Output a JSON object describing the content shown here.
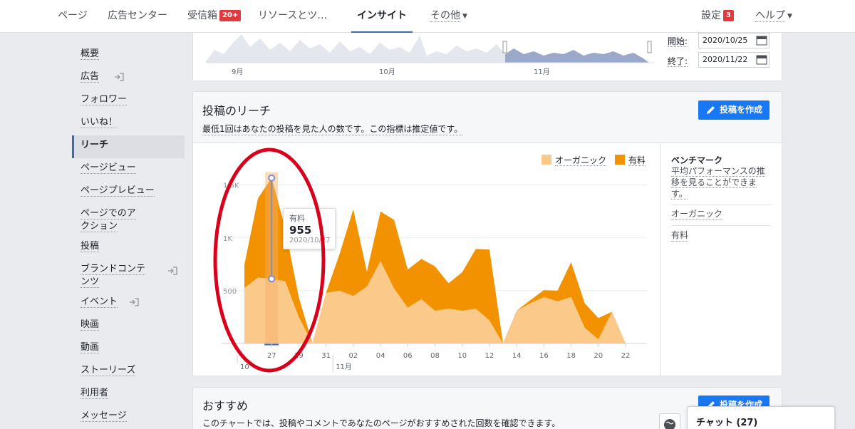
{
  "nav": {
    "page": "ページ",
    "ad_center": "広告センター",
    "inbox": "受信箱",
    "inbox_badge": "20+",
    "resources": "リソースとツ…",
    "insights": "インサイト",
    "more": "その他",
    "settings": "設定",
    "settings_badge": "3",
    "help": "ヘルプ"
  },
  "sidebar": {
    "items": [
      {
        "label": "概要"
      },
      {
        "label": "広告"
      },
      {
        "label": "フォロワー"
      },
      {
        "label": "いいね！"
      },
      {
        "label": "リーチ"
      },
      {
        "label": "ページビュー"
      },
      {
        "label": "ページプレビュー"
      },
      {
        "label": "ページでのアクション"
      },
      {
        "label": "投稿"
      },
      {
        "label": "ブランドコンテンツ"
      },
      {
        "label": "イベント"
      },
      {
        "label": "映画"
      },
      {
        "label": "動画"
      },
      {
        "label": "ストーリーズ"
      },
      {
        "label": "利用者"
      },
      {
        "label": "メッセージ"
      }
    ]
  },
  "range": {
    "months": [
      "9月",
      "10月",
      "11月"
    ],
    "start_label": "開始:",
    "start_value": "2020/10/25",
    "end_label": "終了:",
    "end_value": "2020/11/22"
  },
  "reach_card": {
    "title": "投稿のリーチ",
    "subtitle": "最低1回はあなたの投稿を見た人の数です。この指標は推定値です。",
    "create_button": "投稿を作成"
  },
  "tooltip": {
    "series": "有料",
    "value": "955",
    "date": "2020/10/27"
  },
  "benchmark": {
    "title": "ベンチマーク",
    "desc": "平均パフォーマンスの推移を見ることができます。",
    "organic": "オーガニック",
    "paid": "有料"
  },
  "recommend_card": {
    "title": "おすすめ",
    "subtitle": "このチャートでは、投稿やコメントであなたのページがおすすめされた回数を確認できます。",
    "create_button": "投稿を作成"
  },
  "chat": {
    "label": "チャット (27)"
  },
  "colors": {
    "organic": "#fbc98a",
    "paid": "#f39200",
    "accent": "#4267b2",
    "button": "#1877f2",
    "annotation": "#d9001b"
  },
  "chart_data": {
    "type": "area",
    "stacked": true,
    "legend": [
      "オーガニック",
      "有料"
    ],
    "legend_position": "top-right",
    "yticks": [
      "500",
      "1K",
      "1.5K"
    ],
    "ylim": [
      0,
      1700
    ],
    "x": [
      "10/25",
      "10/26",
      "10/27",
      "10/28",
      "10/29",
      "10/30",
      "10/31",
      "11/01",
      "11/02",
      "11/03",
      "11/04",
      "11/05",
      "11/06",
      "11/07",
      "11/08",
      "11/09",
      "11/10",
      "11/11",
      "11/12",
      "11/13",
      "11/14",
      "11/15",
      "11/16",
      "11/17",
      "11/18",
      "11/19",
      "11/20",
      "11/21",
      "11/22"
    ],
    "xtick_labels": [
      "27",
      "29",
      "31",
      "02",
      "04",
      "06",
      "08",
      "10",
      "12",
      "14",
      "16",
      "18",
      "20",
      "22"
    ],
    "xtick_index": [
      2,
      4,
      6,
      8,
      10,
      12,
      14,
      16,
      18,
      20,
      22,
      24,
      26,
      28
    ],
    "month_labels": [
      "10",
      "11月"
    ],
    "series": [
      {
        "name": "オーガニック",
        "values": [
          525,
          625,
          612,
          590,
          250,
          0,
          480,
          500,
          450,
          540,
          780,
          520,
          340,
          420,
          310,
          330,
          310,
          330,
          220,
          0,
          310,
          380,
          440,
          400,
          440,
          150,
          40,
          300,
          0
        ]
      },
      {
        "name": "有料",
        "values": [
          220,
          750,
          955,
          500,
          185,
          0,
          0,
          350,
          820,
          140,
          470,
          650,
          360,
          380,
          420,
          240,
          365,
          565,
          670,
          0,
          0,
          30,
          65,
          100,
          330,
          230,
          200,
          0,
          0
        ]
      }
    ]
  }
}
